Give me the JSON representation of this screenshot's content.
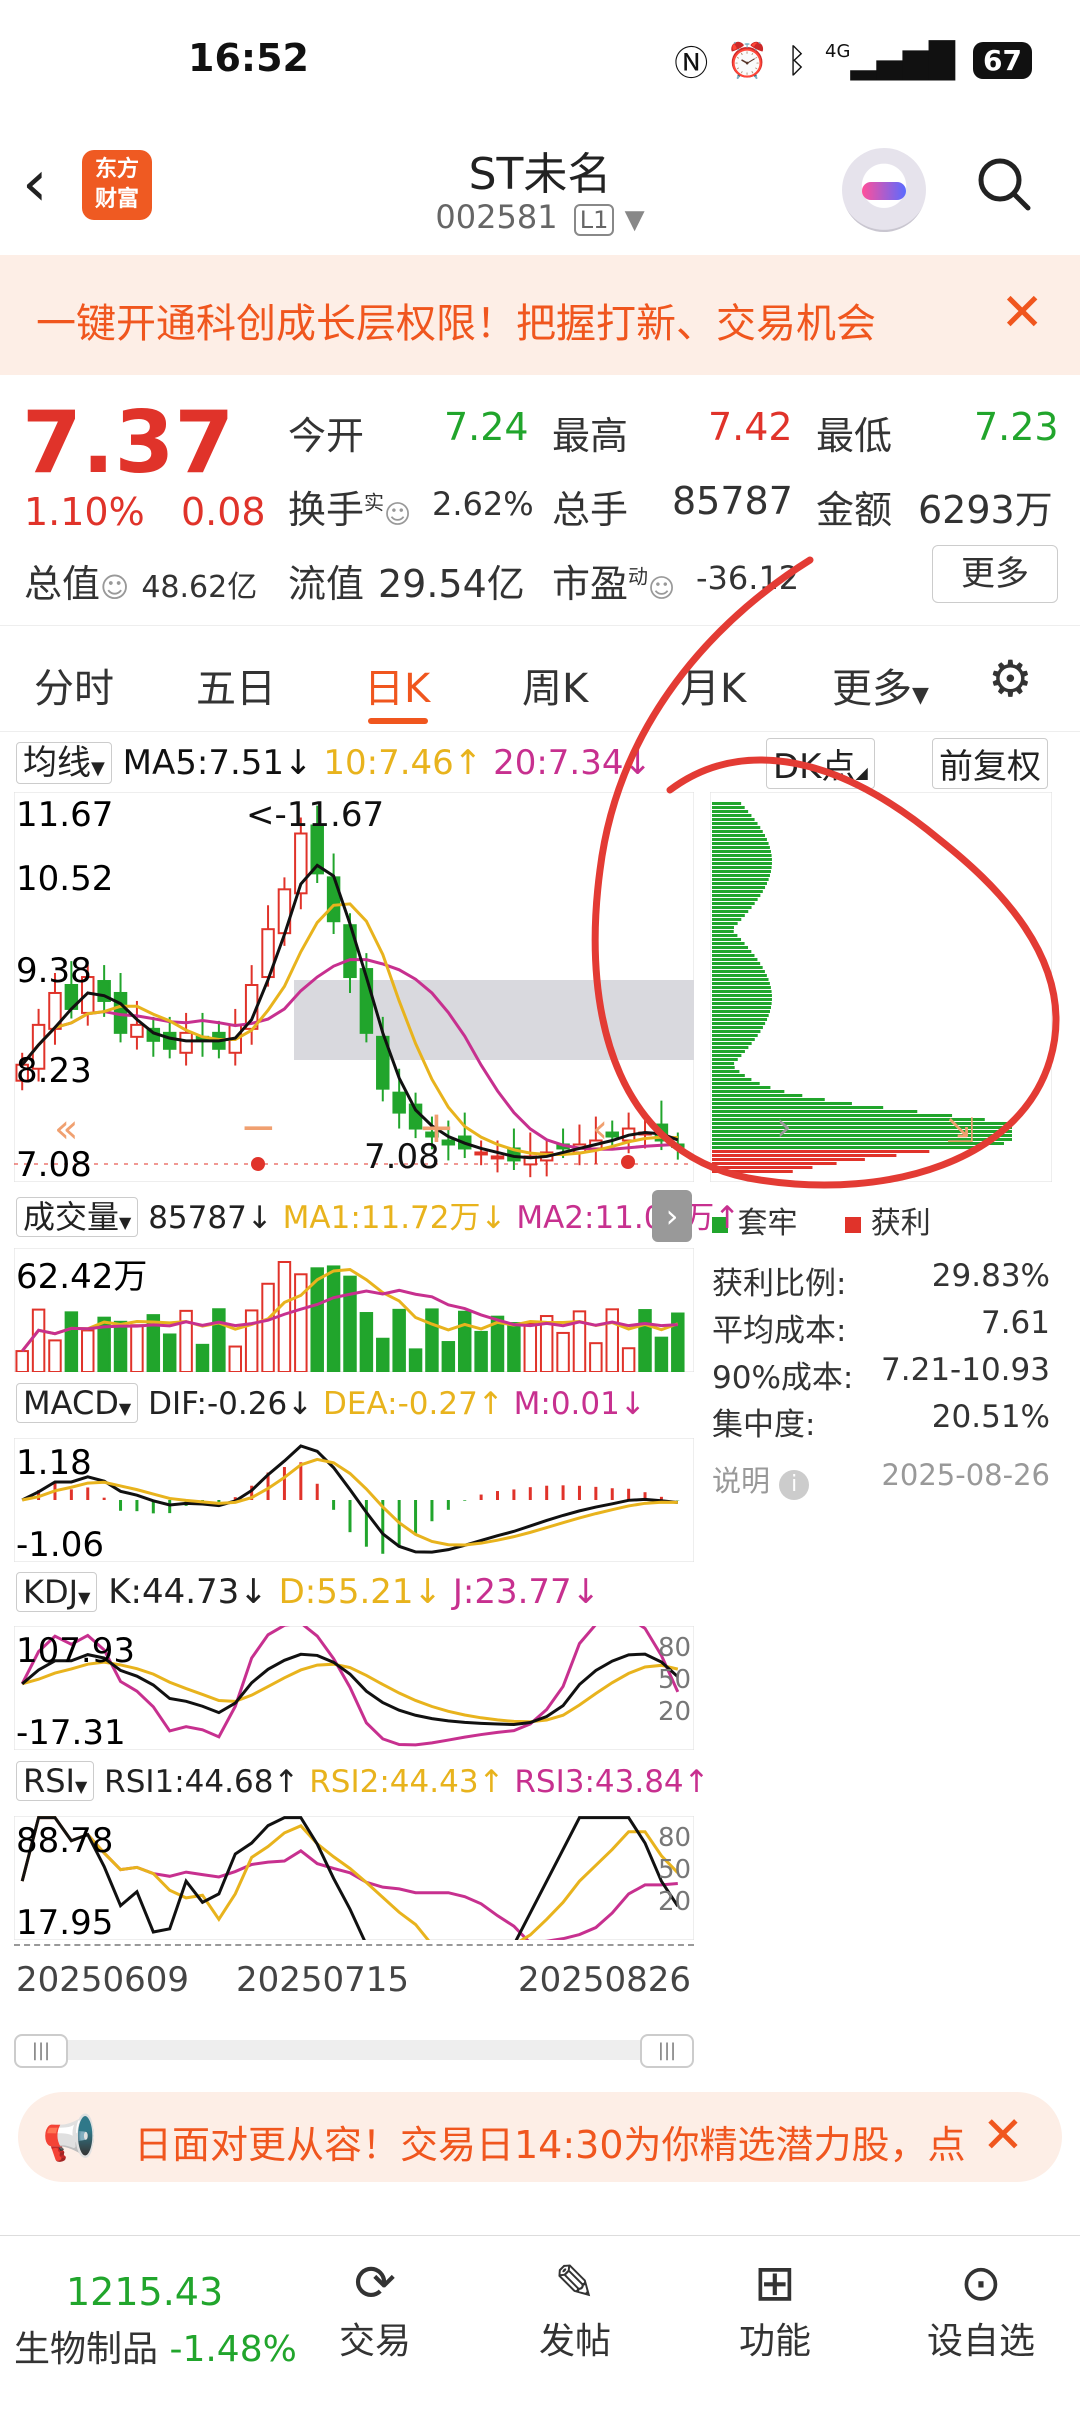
{
  "status_bar": {
    "time": "16:52",
    "network": "4G",
    "battery": "67"
  },
  "header": {
    "stock_name": "ST未名",
    "stock_code": "002581",
    "level_badge": "L1",
    "logo_text_line1": "东方",
    "logo_text_line2": "财富",
    "icons": [
      "back-arrow-icon",
      "robot-avatar-icon",
      "search-icon"
    ]
  },
  "banner": {
    "text": "一键开通科创成长层权限！把握打新、交易机会",
    "close": "✕"
  },
  "quote": {
    "price": "7.37",
    "change_pct": "1.10%",
    "change": "0.08",
    "total_value_label": "总值",
    "total_value": "48.62亿",
    "fields": {
      "open_label": "今开",
      "open": "7.24",
      "high_label": "最高",
      "high": "7.42",
      "low_label": "最低",
      "low": "7.23",
      "turnover_label": "换手",
      "turnover_sup": "实",
      "turnover": "2.62%",
      "volume_label": "总手",
      "volume": "85787",
      "amount_label": "金额",
      "amount": "6293万",
      "float_label": "流值",
      "float_value": "29.54亿",
      "pe_label": "市盈",
      "pe_sup": "动",
      "pe": "-36.12"
    },
    "more_button": "更多"
  },
  "tabs": {
    "items": [
      "分时",
      "五日",
      "日K",
      "周K",
      "月K",
      "更多"
    ],
    "active": "日K"
  },
  "kline": {
    "ma_selector": "均线",
    "ma5": "MA5:7.51↓",
    "ma10": "10:7.46↑",
    "ma20": "20:7.34↓",
    "dk_button": "DK点",
    "adjust_button": "前复权",
    "y_top": "11.67",
    "y_2": "10.52",
    "y_3": "9.38",
    "y_4": "8.23",
    "y_bottom": "7.08",
    "max_marker": "<-11.67",
    "min_marker": "7.08",
    "colors": {
      "up": "#e0332a",
      "down": "#21a52c",
      "ma5": "#111111",
      "ma10": "#e8b31d",
      "ma20": "#c7308f"
    }
  },
  "chips": {
    "legend_trapped": "套牢",
    "legend_profit": "获利",
    "rows": [
      {
        "label": "获利比例:",
        "value": "29.83%"
      },
      {
        "label": "平均成本:",
        "value": "7.61"
      },
      {
        "label": "90%成本:",
        "value": "7.21-10.93"
      },
      {
        "label": "集中度:",
        "value": "20.51%"
      }
    ],
    "note_label": "说明",
    "date": "2025-08-26"
  },
  "volume": {
    "selector": "成交量",
    "value": "85787↓",
    "ma1": "MA1:11.72万↓",
    "ma2": "MA2:11.09万↑",
    "y_top": "62.42万"
  },
  "macd": {
    "selector": "MACD",
    "dif": "DIF:-0.26↓",
    "dea": "DEA:-0.27↑",
    "m": "M:0.01↓",
    "y_top": "1.18",
    "y_bottom": "-1.06"
  },
  "kdj": {
    "selector": "KDJ",
    "k": "K:44.73↓",
    "d": "D:55.21↓",
    "j": "J:23.77↓",
    "y_top": "107.93",
    "y_bottom": "-17.31",
    "r80": "80",
    "r50": "50",
    "r20": "20"
  },
  "rsi": {
    "selector": "RSI",
    "rsi1": "RSI1:44.68↑",
    "rsi2": "RSI2:44.43↑",
    "rsi3": "RSI3:43.84↑",
    "y_top": "88.78",
    "y_bottom": "17.95",
    "r80": "80",
    "r50": "50",
    "r20": "20"
  },
  "dates": {
    "d1": "20250609",
    "d2": "20250715",
    "d3": "20250826"
  },
  "notification": {
    "text": "日面对更从容！交易日14:30为你精选潜力股，点",
    "close": "✕"
  },
  "bottom_bar": {
    "index_value": "1215.43",
    "index_name": "生物制品",
    "index_change": "-1.48%",
    "items": [
      "交易",
      "发帖",
      "功能",
      "设自选"
    ]
  },
  "chart_data": {
    "type": "candlestick",
    "title": "",
    "x_labels": [
      "20250609",
      "20250715",
      "20250826"
    ],
    "ylim": [
      7.08,
      11.67
    ],
    "close_approx": [
      8.4,
      8.9,
      9.3,
      9.1,
      9.5,
      9.2,
      8.8,
      8.9,
      8.7,
      8.6,
      8.8,
      8.7,
      8.6,
      8.9,
      9.4,
      10.1,
      10.6,
      11.3,
      10.8,
      10.2,
      9.5,
      8.8,
      8.1,
      7.8,
      7.6,
      7.5,
      7.4,
      7.35,
      7.3,
      7.25,
      7.2,
      7.25,
      7.3,
      7.35,
      7.4,
      7.45,
      7.5,
      7.6,
      7.55,
      7.45,
      7.37
    ]
  }
}
